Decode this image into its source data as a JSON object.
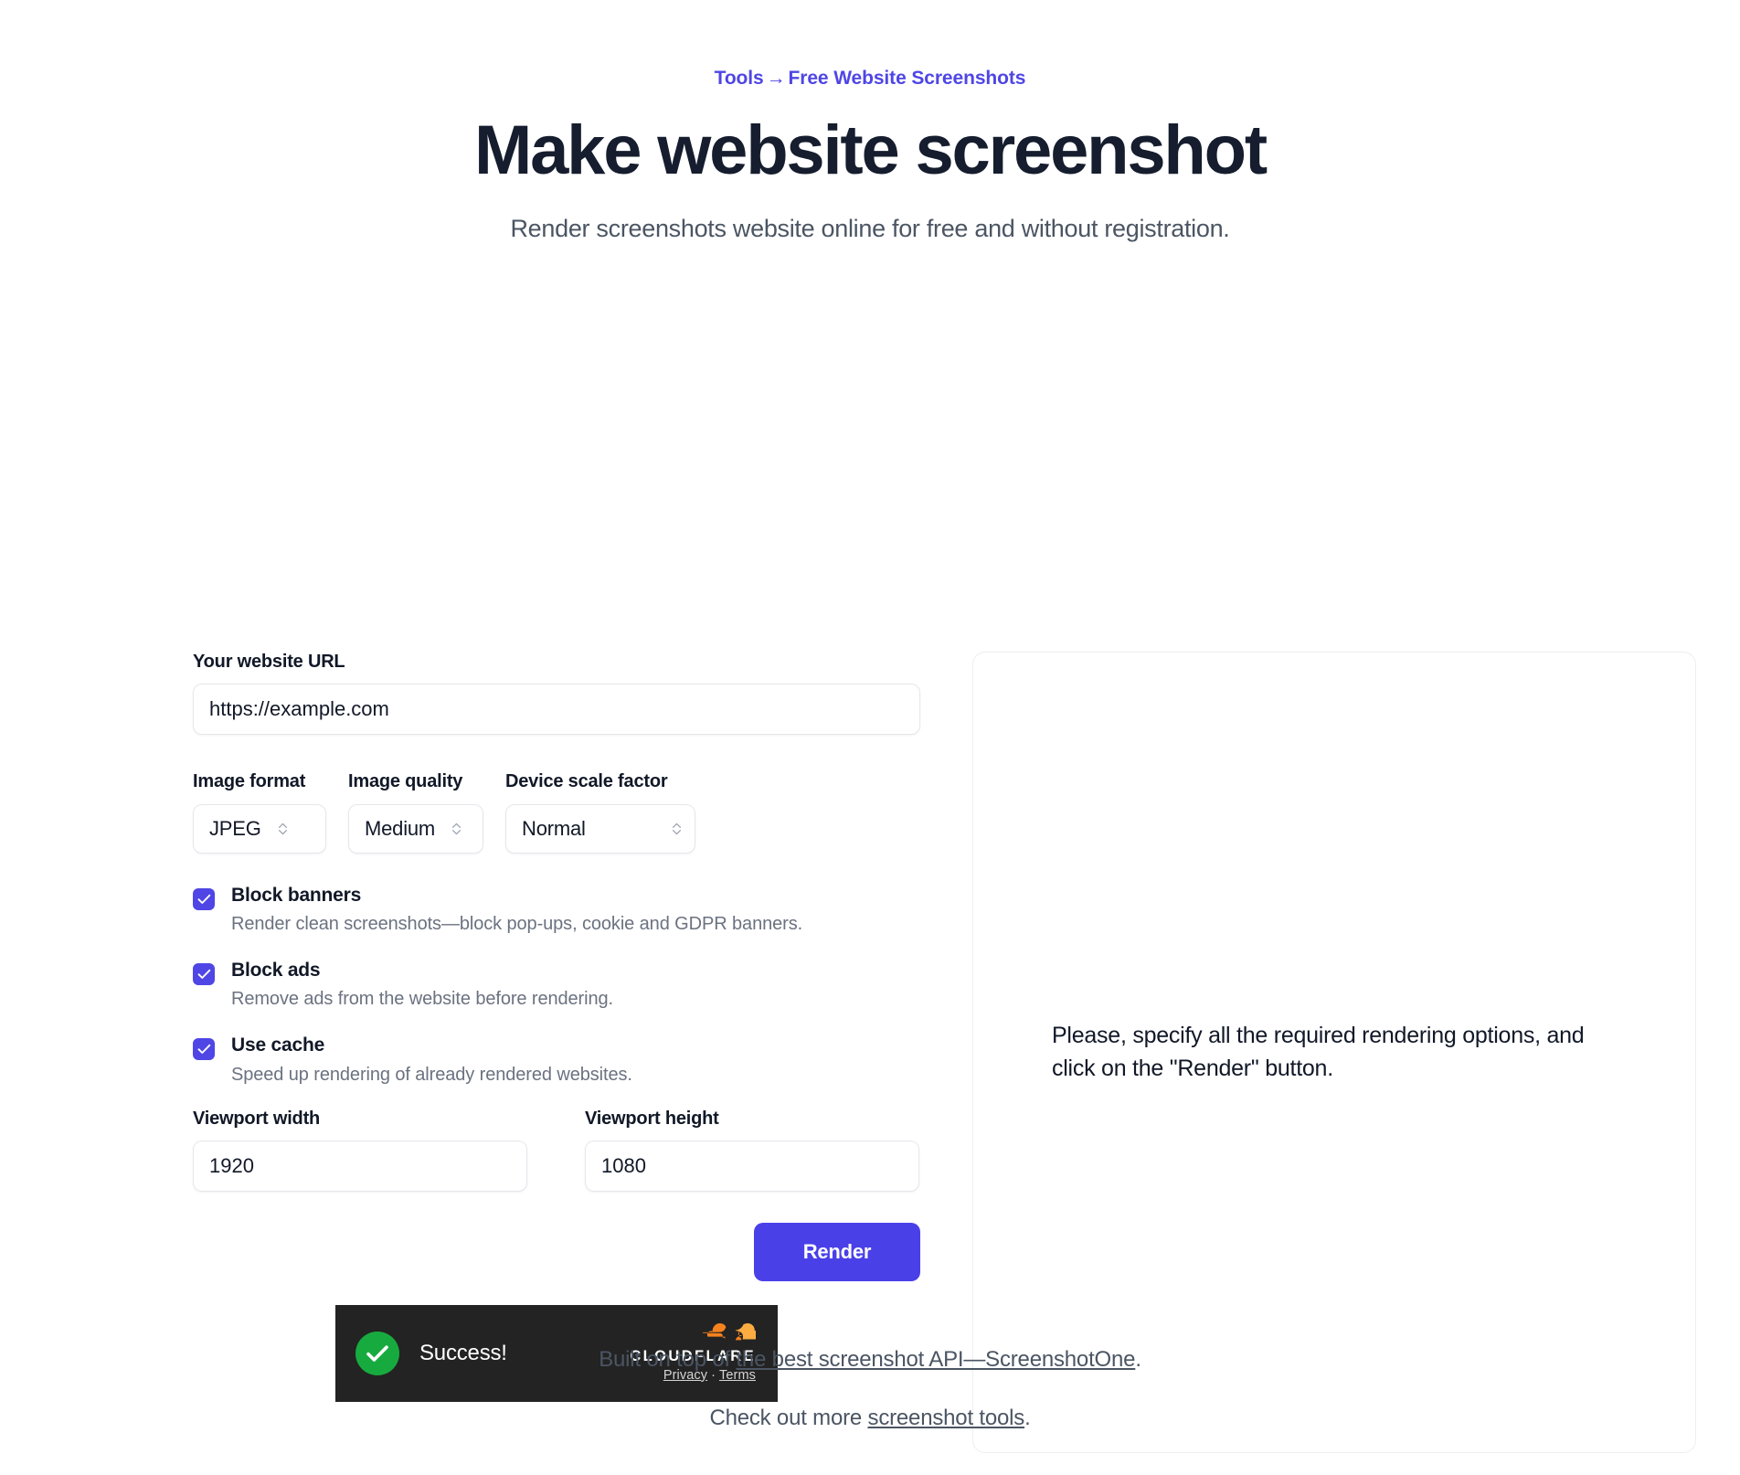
{
  "header": {
    "breadcrumb_parent": "Tools",
    "breadcrumb_arrow": "→",
    "breadcrumb_current": "Free Website Screenshots",
    "title": "Make website screenshot",
    "subtitle": "Render screenshots website online for free and without registration."
  },
  "form": {
    "url_label": "Your website URL",
    "url_value": "https://example.com",
    "url_placeholder": "https://example.com",
    "format_label": "Image format",
    "format_value": "JPEG",
    "quality_label": "Image quality",
    "quality_value": "Medium",
    "scale_label": "Device scale factor",
    "scale_value": "Normal",
    "checkboxes": [
      {
        "title": "Block banners",
        "desc": "Render clean screenshots—block pop-ups, cookie and GDPR banners.",
        "checked": true
      },
      {
        "title": "Block ads",
        "desc": "Remove ads from the website before rendering.",
        "checked": true
      },
      {
        "title": "Use cache",
        "desc": "Speed up rendering of already rendered websites.",
        "checked": true
      }
    ],
    "viewport_width_label": "Viewport width",
    "viewport_width_value": "1920",
    "viewport_height_label": "Viewport height",
    "viewport_height_value": "1080",
    "render_button": "Render"
  },
  "turnstile": {
    "status": "Success!",
    "brand": "CLOUDFLARE",
    "privacy": "Privacy",
    "separator": "·",
    "terms": "Terms",
    "success_color": "#17ab3f",
    "background": "#232323",
    "logo_color": "#f6821f"
  },
  "preview": {
    "message": "Please, specify all the required rendering options, and click on the \"Render\" button."
  },
  "footer": {
    "line1_prefix": "Built on top of ",
    "line1_link": "the best screenshot API—ScreenshotOne",
    "line1_suffix": ".",
    "line2_prefix": "Check out more ",
    "line2_link": "screenshot tools",
    "line2_suffix": "."
  },
  "theme": {
    "accent": "#4f46e5",
    "button": "#4a40e8",
    "title_color": "#151d2e",
    "muted": "#6b7280"
  }
}
